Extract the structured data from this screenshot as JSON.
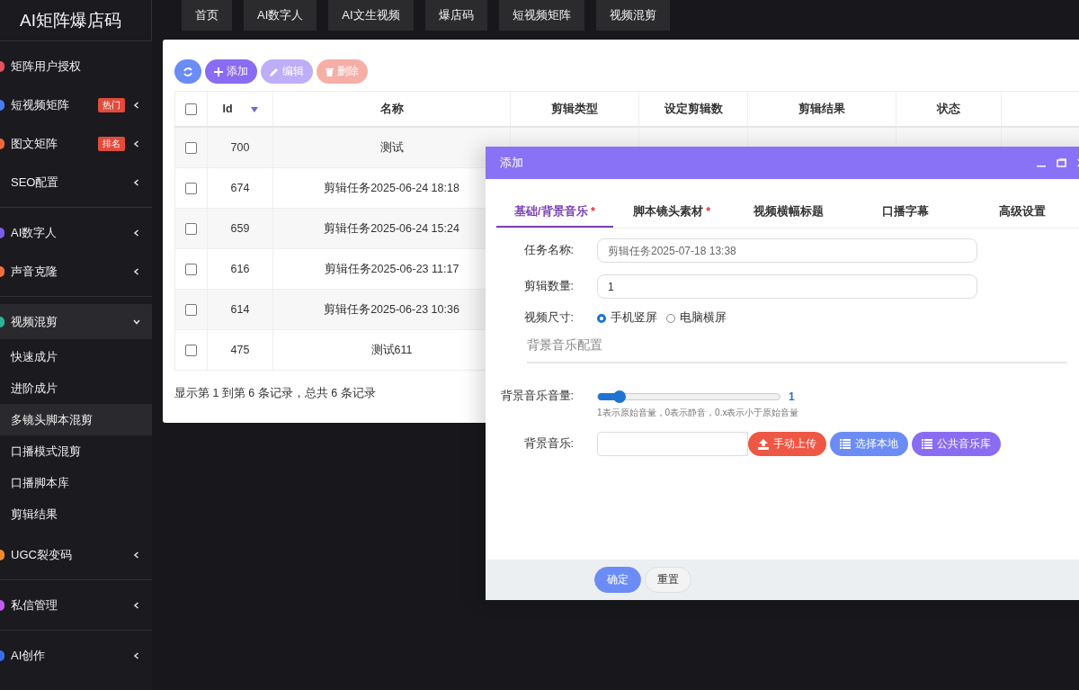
{
  "logo": "AI矩阵爆店码",
  "nav": [
    "首页",
    "AI数字人",
    "AI文生视频",
    "爆店码",
    "短视频矩阵",
    "视频混剪"
  ],
  "sidebar": {
    "groups": [
      [
        {
          "label": "矩阵用户授权",
          "color": "#e8505b",
          "selected": false
        },
        {
          "label": "短视频矩阵",
          "color": "#4a7cf0",
          "badge": "热门",
          "expanded": false,
          "selected": false
        },
        {
          "label": "图文矩阵",
          "color": "#f0683c",
          "badge": "排名",
          "expanded": false,
          "selected": false
        },
        {
          "label": "SEO配置",
          "expanded": false,
          "selected": false
        }
      ],
      [
        {
          "label": "AI数字人",
          "color": "#7b5cf0",
          "expanded": false,
          "selected": false
        },
        {
          "label": "声音克隆",
          "color": "#f07040",
          "expanded": false,
          "selected": false
        }
      ],
      [
        {
          "label": "视频混剪",
          "color": "#2bb59a",
          "expanded": true,
          "selected": false,
          "children": [
            {
              "label": "快速成片",
              "selected": false
            },
            {
              "label": "进阶成片",
              "selected": false
            },
            {
              "label": "多镜头脚本混剪",
              "selected": true
            },
            {
              "label": "口播模式混剪",
              "selected": false
            },
            {
              "label": "口播脚本库",
              "selected": false
            },
            {
              "label": "剪辑结果",
              "selected": false
            }
          ]
        },
        {
          "label": "UGC裂变码",
          "color": "#f08a30",
          "expanded": false,
          "selected": false
        }
      ],
      [
        {
          "label": "私信管理",
          "color": "#c05cf0",
          "expanded": false,
          "selected": false
        }
      ],
      [
        {
          "label": "AI创作",
          "color": "#3a6cf0",
          "expanded": false,
          "selected": false
        }
      ]
    ]
  },
  "toolbar": [
    {
      "kind": "refresh",
      "disabled": false
    },
    {
      "kind": "add",
      "label": "添加",
      "disabled": false
    },
    {
      "kind": "edit",
      "label": "编辑",
      "disabled": true
    },
    {
      "kind": "delete",
      "label": "删除",
      "disabled": true
    }
  ],
  "table": {
    "all_checked": false,
    "columns": [
      "Id",
      "名称",
      "剪辑类型",
      "设定剪辑数",
      "剪辑结果",
      "状态"
    ],
    "rows": [
      {
        "checked": false,
        "id": "700",
        "name": "测试"
      },
      {
        "checked": false,
        "id": "674",
        "name": "剪辑任务2025-06-24 18:18"
      },
      {
        "checked": false,
        "id": "659",
        "name": "剪辑任务2025-06-24 15:24"
      },
      {
        "checked": false,
        "id": "616",
        "name": "剪辑任务2025-06-23 11:17"
      },
      {
        "checked": false,
        "id": "614",
        "name": "剪辑任务2025-06-23 10:36"
      },
      {
        "checked": false,
        "id": "475",
        "name": "测试611"
      }
    ],
    "footer": "显示第 1 到第 6 条记录，总共 6 条记录"
  },
  "dialog": {
    "title": "添加",
    "tabs": [
      {
        "label": "基础/背景音乐",
        "required_mark": "*",
        "selected": true
      },
      {
        "label": "脚本镜头素材",
        "required_mark": "*",
        "selected": false
      },
      {
        "label": "视频横幅标题",
        "selected": false
      },
      {
        "label": "口播字幕",
        "selected": false
      },
      {
        "label": "高级设置",
        "selected": false
      }
    ],
    "task_name": {
      "label": "任务名称:",
      "placeholder": "剪辑任务2025-07-18 13:38"
    },
    "clip_count": {
      "label": "剪辑数量:",
      "value": "1"
    },
    "video_size": {
      "label": "视频尺寸:",
      "options": [
        {
          "label": "手机竖屏",
          "selected": true
        },
        {
          "label": "电脑横屏",
          "selected": false
        }
      ]
    },
    "section": "背景音乐配置",
    "volume": {
      "label": "背景音乐音量:",
      "level": 0.12,
      "reading": "1",
      "hint": "1表示原始音量，0表示静音，0.x表示小于原始音量"
    },
    "music": {
      "label": "背景音乐:",
      "buttons": [
        {
          "kind": "upload",
          "label": "手动上传"
        },
        {
          "kind": "local",
          "label": "选择本地"
        },
        {
          "kind": "library",
          "label": "公共音乐库"
        }
      ]
    },
    "footer_buttons": [
      {
        "kind": "primary",
        "label": "确定"
      },
      {
        "kind": "secondary",
        "label": "重置"
      }
    ]
  }
}
